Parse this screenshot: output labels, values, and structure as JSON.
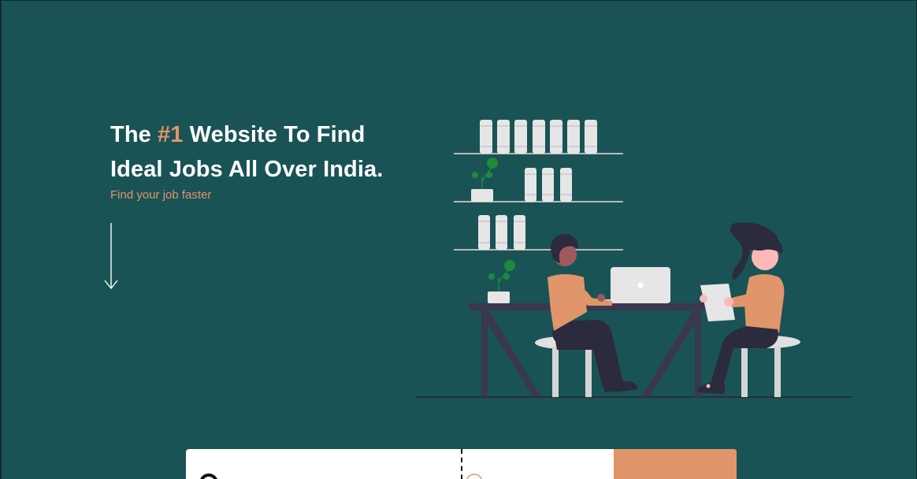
{
  "hero": {
    "headline_prefix": "The ",
    "headline_accent": "#1",
    "headline_line1_rest": " Website To Find",
    "headline_line2": "Ideal Jobs All Over India.",
    "subline": "Find your job faster"
  },
  "icons": {
    "scroll": "arrow-down-icon",
    "search": "search-icon",
    "location": "location-pin-icon"
  },
  "search": {
    "keyword_placeholder": "",
    "location_placeholder": "",
    "button_label": ""
  },
  "colors": {
    "background": "#1a5355",
    "accent": "#e0956b",
    "text": "#ffffff"
  }
}
